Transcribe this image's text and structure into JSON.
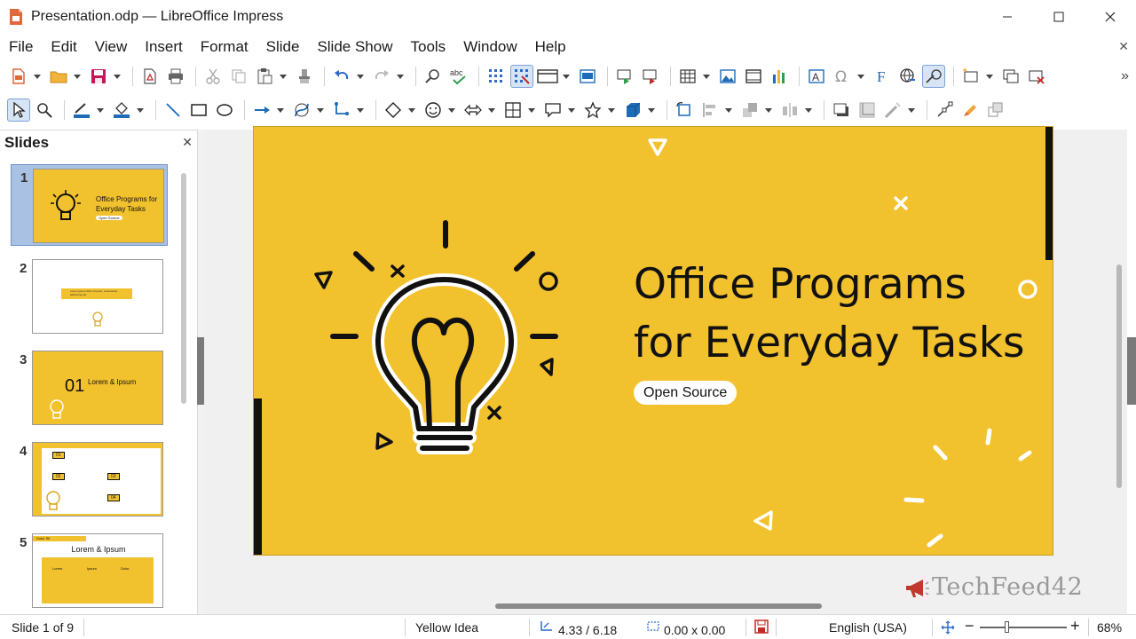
{
  "window": {
    "title": "Presentation.odp — LibreOffice Impress",
    "controls": {
      "minimize": "minimize-icon",
      "maximize": "maximize-icon",
      "close": "close-icon"
    }
  },
  "menu": [
    "File",
    "Edit",
    "View",
    "Insert",
    "Format",
    "Slide",
    "Slide Show",
    "Tools",
    "Window",
    "Help"
  ],
  "slides_pane": {
    "title": "Slides",
    "slides": [
      {
        "number": "1",
        "title": "Office Programs for Everyday Tasks",
        "label": "Open Source"
      },
      {
        "number": "2",
        "lines": "Lorem ipsum dolor sit amet, consectetur adipiscing elit"
      },
      {
        "number": "3",
        "big": "01",
        "title": "Lorem & Ipsum"
      },
      {
        "number": "4",
        "labels": [
          "01",
          "02",
          "03",
          "04"
        ]
      },
      {
        "number": "5",
        "tag": "Dolor Sit",
        "title": "Lorem & Ipsum",
        "cols": [
          "Lorem",
          "Ipsum",
          "Dolor"
        ]
      }
    ]
  },
  "slide": {
    "title_line1": "Office Programs",
    "title_line2": "for Everyday Tasks",
    "pill": "Open Source",
    "colors": {
      "background": "#f2c12e",
      "ink": "#111111",
      "white": "#ffffff"
    }
  },
  "status": {
    "slide": "Slide 1 of 9",
    "master": "Yellow Idea",
    "position": "4.33 / 6.18",
    "size": "0.00 x 0.00",
    "language": "English (USA)",
    "zoom": "68%"
  },
  "watermark": {
    "text": "TechFeed42"
  },
  "colors": {
    "accent": "#2a6ac8",
    "selection": "#a9c1e3"
  }
}
